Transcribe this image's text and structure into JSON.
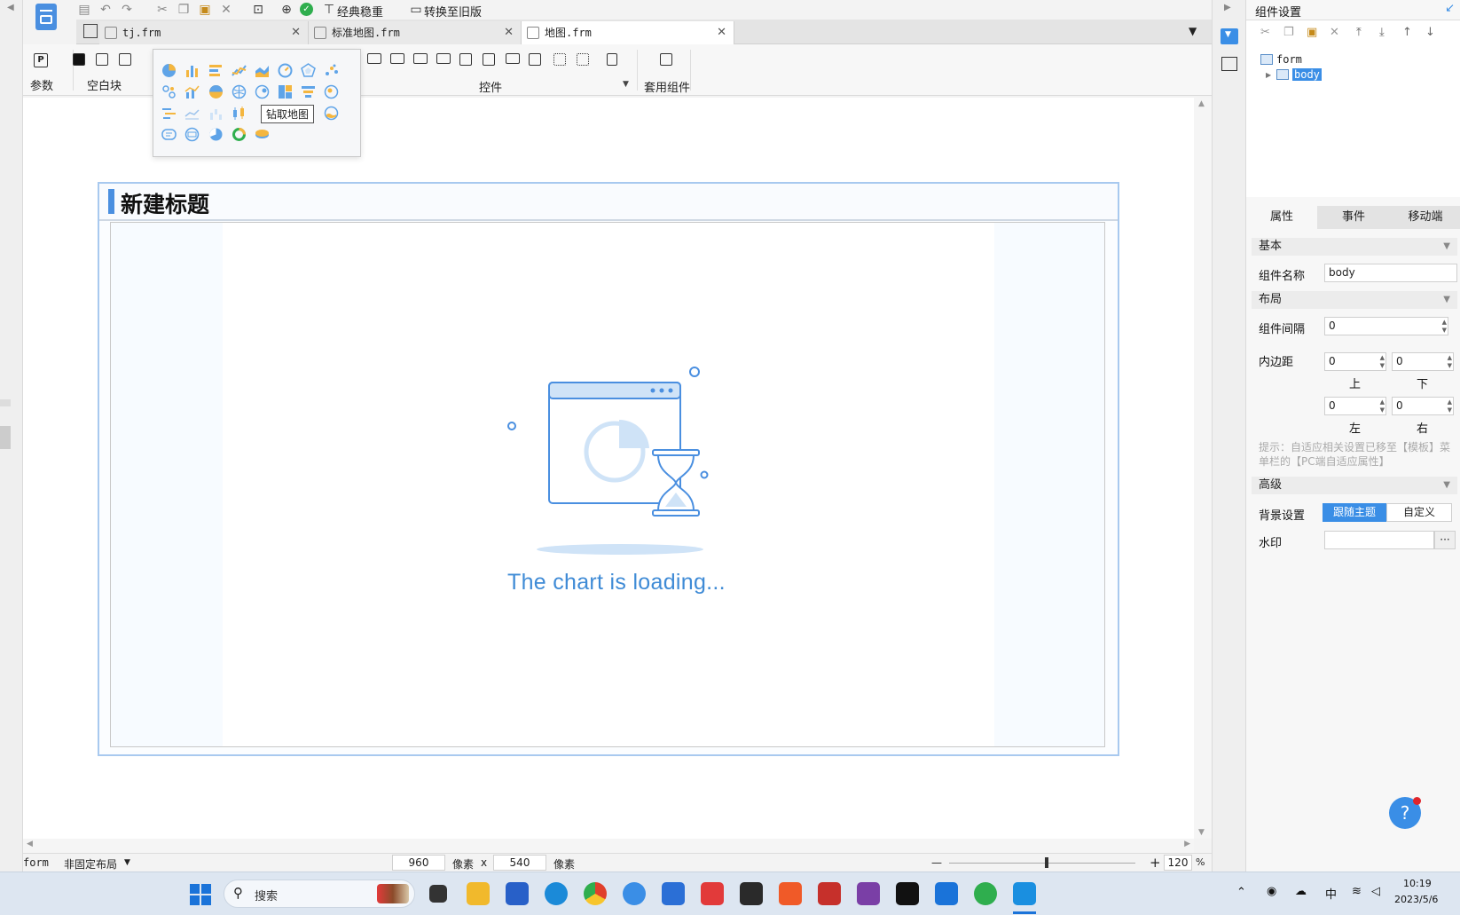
{
  "toolbar": {
    "classic_label": "经典稳重",
    "convert_label": "转换至旧版"
  },
  "tabs": [
    {
      "label": "tj.frm"
    },
    {
      "label": "标准地图.frm"
    },
    {
      "label": "地图.frm"
    }
  ],
  "ribbon": {
    "param_label": "参数",
    "blank_label": "空白块",
    "controls_label": "控件",
    "template_label": "套用组件"
  },
  "palette": {
    "tooltip": "钻取地图"
  },
  "widget": {
    "title": "新建标题",
    "loading_text": "The chart is loading..."
  },
  "statusbar": {
    "form_label": "form",
    "layout_label": "非固定布局",
    "width": "960",
    "unit1": "像素",
    "times": "x",
    "height": "540",
    "unit2": "像素",
    "zoom": "120",
    "percent": "%"
  },
  "panel": {
    "title": "组件设置",
    "tree_root": "form",
    "tree_child": "body",
    "tabs": [
      "属性",
      "事件",
      "移动端"
    ],
    "sec_basic": "基本",
    "name_label": "组件名称",
    "name_value": "body",
    "sec_layout": "布局",
    "gap_label": "组件间隔",
    "gap_value": "0",
    "padding_label": "内边距",
    "pad_top": "0",
    "pad_bottom": "0",
    "pad_left": "0",
    "pad_right": "0",
    "top_label": "上",
    "bottom_label": "下",
    "left_label": "左",
    "right_label": "右",
    "hint": "提示：自适应相关设置已移至【模板】菜单栏的【PC端自适应属性】",
    "sec_advanced": "高级",
    "bg_label": "背景设置",
    "bg_follow": "跟随主题",
    "bg_custom": "自定义",
    "watermark_label": "水印",
    "watermark_more": "···"
  },
  "taskbar": {
    "search_placeholder": "搜索",
    "ime": "中",
    "time": "10:19",
    "date": "2023/5/6"
  },
  "colors": {
    "accent": "#4a8fe0",
    "loading_blue": "#3f8bd6",
    "help": "#3a8ee6"
  }
}
